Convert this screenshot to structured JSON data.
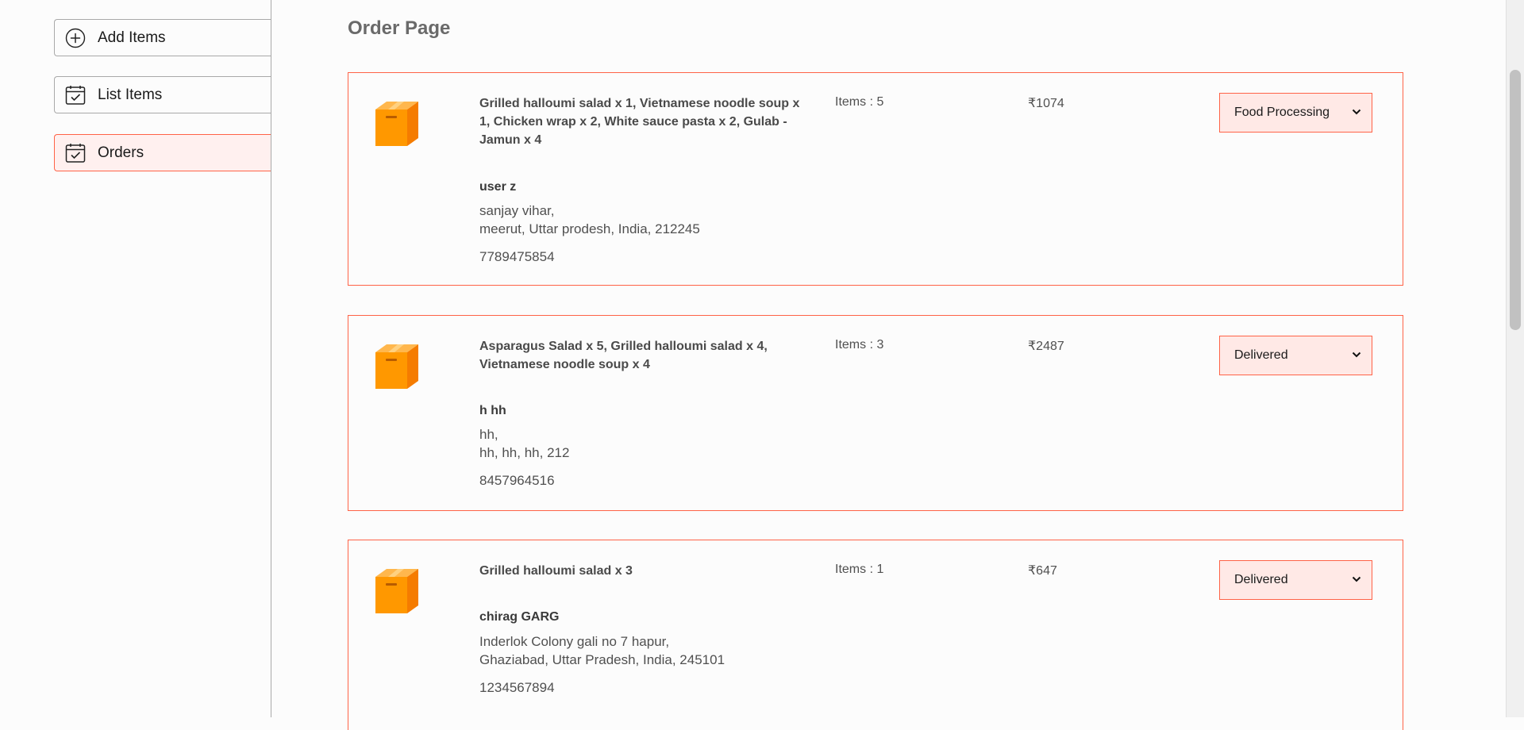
{
  "sidebar": {
    "items": [
      {
        "label": "Add Items",
        "icon": "plus-circle-icon"
      },
      {
        "label": "List Items",
        "icon": "calendar-check-icon"
      },
      {
        "label": "Orders",
        "icon": "calendar-check-icon",
        "active": true
      }
    ]
  },
  "page": {
    "title": "Order Page"
  },
  "orders": [
    {
      "items": "Grilled halloumi salad x 1, Vietnamese noodle soup x 1, Chicken wrap x 2, White sauce pasta x 2, Gulab - Jamun x 4",
      "customer": "user z",
      "address_line1": "sanjay vihar,",
      "address_line2": "meerut, Uttar prodesh, India, 212245",
      "phone": "7789475854",
      "count": "Items : 5",
      "amount": "₹1074",
      "status": "Food Processing"
    },
    {
      "items": "Asparagus Salad x 5, Grilled halloumi salad x 4, Vietnamese noodle soup x 4",
      "customer": "h hh",
      "address_line1": "hh,",
      "address_line2": "hh, hh, hh, 212",
      "phone": "8457964516",
      "count": "Items : 3",
      "amount": "₹2487",
      "status": "Delivered"
    },
    {
      "items": "Grilled halloumi salad x 3",
      "customer": "chirag GARG",
      "address_line1": "Inderlok Colony gali no 7 hapur,",
      "address_line2": "Ghaziabad, Uttar Pradesh, India, 245101",
      "phone": "1234567894",
      "count": "Items : 1",
      "amount": "₹647",
      "status": "Delivered"
    }
  ],
  "colors": {
    "accent": "#ff6347",
    "active_bg": "#fff0ef",
    "select_bg": "#ffe9e6",
    "parcel_orange": "#ff9800"
  }
}
